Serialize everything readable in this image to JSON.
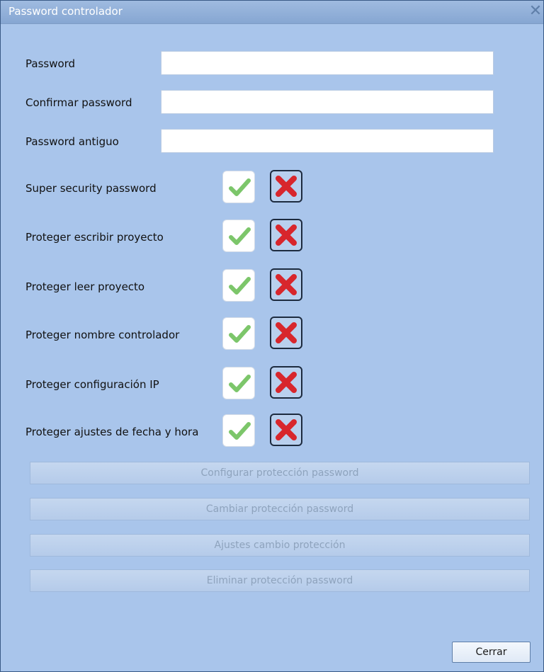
{
  "window": {
    "title": "Password controlador",
    "close_icon": "close-icon"
  },
  "fields": [
    {
      "label": "Password",
      "value": ""
    },
    {
      "label": "Confirmar password",
      "value": ""
    },
    {
      "label": "Password antiguo",
      "value": ""
    }
  ],
  "options": [
    {
      "label": "Super security password"
    },
    {
      "label": "Proteger escribir proyecto"
    },
    {
      "label": "Proteger leer proyecto"
    },
    {
      "label": "Proteger nombre controlador"
    },
    {
      "label": "Proteger configuración IP"
    },
    {
      "label": "Proteger ajustes de fecha y hora"
    }
  ],
  "icons": {
    "yes": "check-icon",
    "no": "cross-icon"
  },
  "actions": {
    "configure": "Configurar protección password",
    "change": "Cambiar protección password",
    "settings": "Ajustes cambio protección",
    "remove": "Eliminar protección password"
  },
  "close_button": "Cerrar",
  "colors": {
    "background": "#a9c5eb",
    "titlebar": "#8fb0dc",
    "check": "#7cc66a",
    "cross": "#d8262c"
  }
}
